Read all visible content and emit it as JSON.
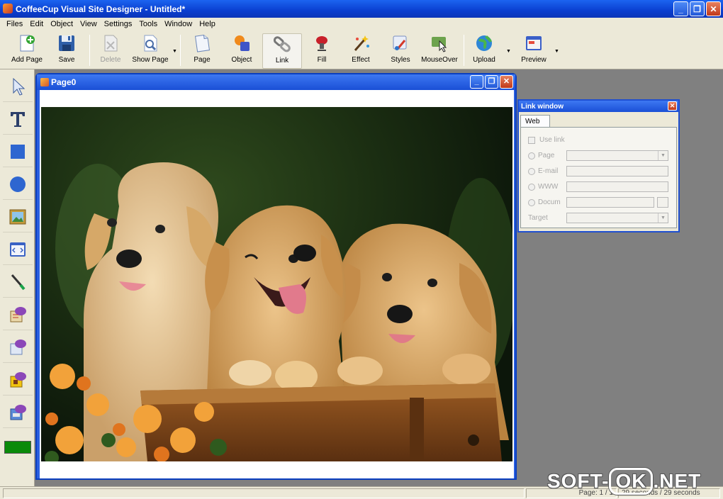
{
  "window": {
    "title": "CoffeeCup Visual Site Designer - Untitled*"
  },
  "menu": [
    "Files",
    "Edit",
    "Object",
    "View",
    "Settings",
    "Tools",
    "Window",
    "Help"
  ],
  "toolbar": {
    "add_page": "Add Page",
    "save": "Save",
    "delete": "Delete",
    "show_page": "Show Page",
    "page": "Page",
    "object": "Object",
    "link": "Link",
    "fill": "Fill",
    "effect": "Effect",
    "styles": "Styles",
    "mouseover": "MouseOver",
    "upload": "Upload",
    "preview": "Preview"
  },
  "page_window": {
    "title": "Page0"
  },
  "link_window": {
    "title": "Link window",
    "tab": "Web",
    "use_link": "Use link",
    "page": "Page",
    "email": "E-mail",
    "www": "WWW",
    "docum": "Docum",
    "target": "Target"
  },
  "status": {
    "page": "Page: 1 / 1",
    "time": "29 seconds / 29 seconds"
  },
  "watermark": {
    "left": "SOFT-",
    "mid": "OK",
    "right": ".NET"
  },
  "colors": {
    "xp_blue": "#0a3fd0",
    "toolbar_bg": "#ece9d8",
    "workspace": "#808080",
    "swatch": "#0a8a0a"
  }
}
